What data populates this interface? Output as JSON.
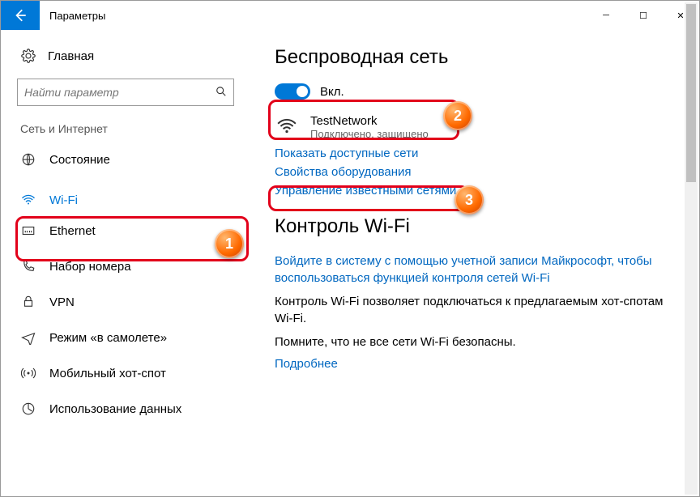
{
  "titlebar": {
    "title": "Параметры"
  },
  "sidebar": {
    "home": "Главная",
    "search_placeholder": "Найти параметр",
    "category": "Сеть и Интернет",
    "items": [
      {
        "label": "Состояние"
      },
      {
        "label": "Wi-Fi"
      },
      {
        "label": "Ethernet"
      },
      {
        "label": "Набор номера"
      },
      {
        "label": "VPN"
      },
      {
        "label": "Режим «в самолете»"
      },
      {
        "label": "Мобильный хот-спот"
      },
      {
        "label": "Использование данных"
      }
    ]
  },
  "main": {
    "heading1": "Беспроводная сеть",
    "toggle_label": "Вкл.",
    "network": {
      "name": "TestNetwork",
      "status": "Подключено, защищено"
    },
    "link_available": "Показать доступные сети",
    "link_hardware": "Свойства оборудования",
    "link_known": "Управление известными сетями",
    "heading2": "Контроль Wi-Fi",
    "link_signin": "Войдите в систему с помощью учетной записи Майкрософт, чтобы воспользоваться функцией контроля сетей Wi-Fi",
    "text1": "Контроль Wi-Fi позволяет подключаться к предлагаемым хот-спотам Wi-Fi.",
    "text2": "Помните, что не все сети Wi-Fi безопасны.",
    "link_more": "Подробнее"
  },
  "badges": {
    "b1": "1",
    "b2": "2",
    "b3": "3"
  }
}
